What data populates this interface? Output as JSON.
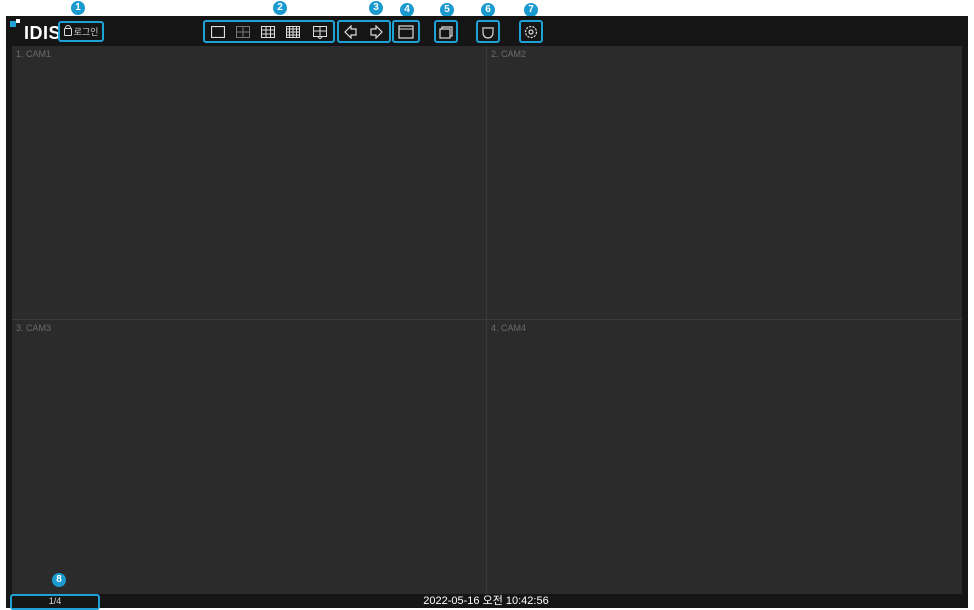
{
  "app": {
    "brand": "IDIS",
    "accent_color": "#1fa1d6"
  },
  "toolbar": {
    "login_label": "로그인",
    "badges": [
      "1",
      "2",
      "3",
      "4",
      "5",
      "6",
      "7"
    ],
    "layout_icons": [
      "single-layout-icon",
      "quad-layout-icon",
      "nine-split-layout-icon",
      "sixteen-split-layout-icon",
      "custom-layout-icon"
    ],
    "nav_icons": [
      "previous-page-icon",
      "next-page-icon"
    ],
    "other_icons": [
      "fullscreen-icon",
      "sequence-icon",
      "camera-ptz-icon",
      "settings-gear-icon"
    ]
  },
  "cameras": [
    {
      "label": "1. CAM1"
    },
    {
      "label": "2. CAM2"
    },
    {
      "label": "3. CAM3"
    },
    {
      "label": "4. CAM4"
    }
  ],
  "status": {
    "badge": "8",
    "page_indicator": "1/4",
    "datetime": "2022-05-16  오전 10:42:56"
  }
}
